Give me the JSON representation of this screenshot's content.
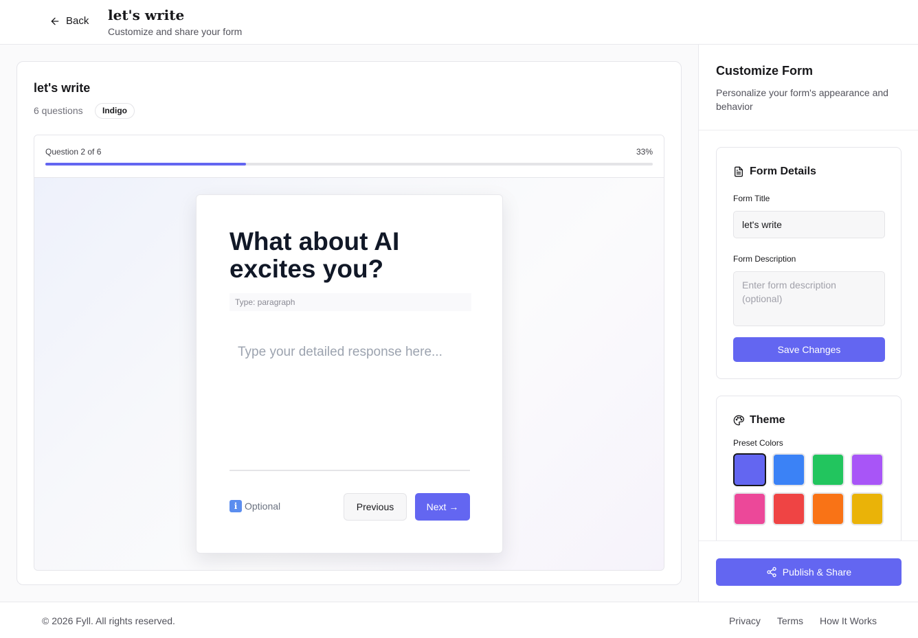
{
  "header": {
    "back_label": "Back",
    "title": "let's write",
    "subtitle": "Customize and share your form"
  },
  "preview": {
    "form_title": "let's write",
    "question_count": "6 questions",
    "theme_badge": "Indigo",
    "progress_label": "Question 2 of 6",
    "progress_percent_label": "33%",
    "progress_fraction": 0.33,
    "question": {
      "text": "What about AI excites you?",
      "type_label": "Type: paragraph",
      "answer_placeholder": "Type your detailed response here...",
      "optional_icon": "info-icon",
      "optional_icon_glyph": "i",
      "optional_label": "Optional",
      "previous_label": "Previous",
      "next_label": "Next →"
    }
  },
  "sidebar": {
    "title": "Customize Form",
    "description": "Personalize your form's appearance and behavior",
    "details": {
      "heading": "Form Details",
      "title_label": "Form Title",
      "title_value": "let's write",
      "description_label": "Form Description",
      "description_placeholder": "Enter form description (optional)",
      "description_value": "",
      "save_label": "Save Changes"
    },
    "theme": {
      "heading": "Theme",
      "preset_label": "Preset Colors",
      "swatches": [
        {
          "name": "indigo",
          "color": "#6366f1",
          "selected": true
        },
        {
          "name": "blue",
          "color": "#3b82f6",
          "selected": false
        },
        {
          "name": "green",
          "color": "#22c55e",
          "selected": false
        },
        {
          "name": "purple",
          "color": "#a855f7",
          "selected": false
        },
        {
          "name": "pink",
          "color": "#ec4899",
          "selected": false
        },
        {
          "name": "red",
          "color": "#ef4444",
          "selected": false
        },
        {
          "name": "orange",
          "color": "#f97316",
          "selected": false
        },
        {
          "name": "yellow",
          "color": "#eab308",
          "selected": false
        }
      ]
    },
    "publish_label": "Publish & Share"
  },
  "footer": {
    "copyright": "© 2026 Fyll. All rights reserved.",
    "links": [
      "Privacy",
      "Terms",
      "How It Works"
    ]
  },
  "colors": {
    "accent": "#6366f1"
  }
}
